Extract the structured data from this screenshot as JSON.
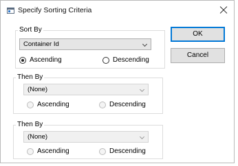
{
  "window": {
    "title": "Specify Sorting Criteria",
    "app_icon": "dialog-window-icon",
    "close_icon": "close-icon"
  },
  "sort_by": {
    "label": "Sort By",
    "selected_field": "Container Id",
    "ascending_label": "Ascending",
    "descending_label": "Descending",
    "selected_order": "Ascending"
  },
  "then_by_1": {
    "label": "Then By",
    "selected_field": "(None)",
    "ascending_label": "Ascending",
    "descending_label": "Descending"
  },
  "then_by_2": {
    "label": "Then By",
    "selected_field": "(None)",
    "ascending_label": "Ascending",
    "descending_label": "Descending"
  },
  "buttons": {
    "ok_label": "OK",
    "cancel_label": "Cancel"
  },
  "colors": {
    "default_button_border": "#0078d7"
  }
}
